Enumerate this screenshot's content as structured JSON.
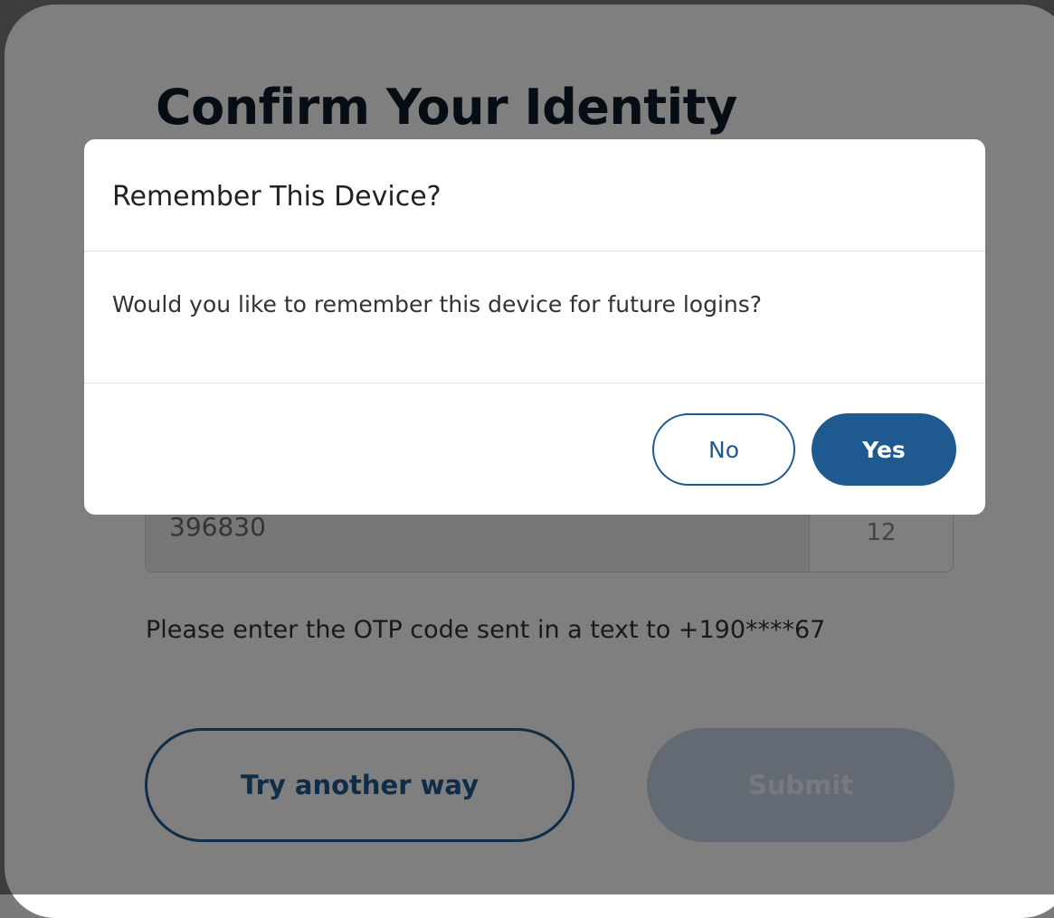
{
  "page": {
    "title": "Confirm Your Identity",
    "otp_value": "396830",
    "otp_timer": "12",
    "otp_hint": "Please enter the OTP code sent in a text to +190****67",
    "try_another_label": "Try another way",
    "submit_label": "Submit"
  },
  "modal": {
    "title": "Remember This Device?",
    "body": "Would you like to remember this device for future logins?",
    "no_label": "No",
    "yes_label": "Yes"
  },
  "colors": {
    "accent": "#1e5a8f",
    "title_text": "#0d1b2a",
    "submit_disabled": "#c6d5e8",
    "overlay": "rgba(0,0,0,0.5)"
  }
}
